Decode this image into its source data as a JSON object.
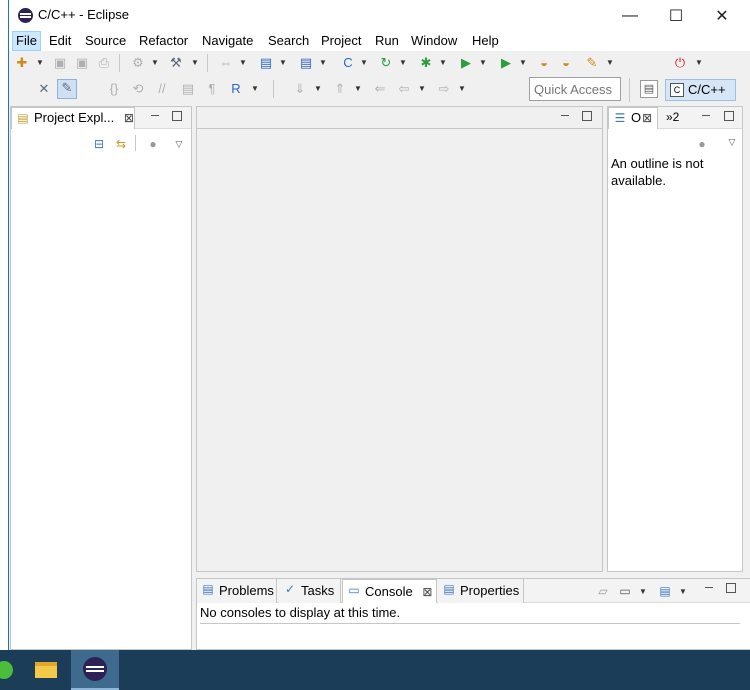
{
  "window": {
    "title": "C/C++ - Eclipse",
    "controls": {
      "minimize": "—",
      "maximize": "☐",
      "close": "✕"
    }
  },
  "menu": [
    "File",
    "Edit",
    "Source",
    "Refactor",
    "Navigate",
    "Search",
    "Project",
    "Run",
    "Window",
    "Help"
  ],
  "quick_access": {
    "placeholder": "Quick Access"
  },
  "perspective": {
    "label": "C/C++"
  },
  "project_explorer": {
    "tab_label": "Project Expl...",
    "close": "⊠"
  },
  "outline": {
    "tab_label": "O",
    "close": "⊠",
    "overflow": "»2",
    "message": "An outline is not available."
  },
  "bottom_panel": {
    "tabs": [
      {
        "label": "Problems",
        "icon": "problems-icon"
      },
      {
        "label": "Tasks",
        "icon": "tasks-icon"
      },
      {
        "label": "Console",
        "icon": "console-icon",
        "close": "⊠"
      },
      {
        "label": "Properties",
        "icon": "properties-icon"
      }
    ],
    "console_message": "No consoles to display at this time."
  },
  "taskbar": {
    "apps": [
      "green-app-icon",
      "file-explorer-icon",
      "eclipse-icon"
    ]
  },
  "colors": {
    "accent": "#1a73c9",
    "taskbar": "#1b3d57",
    "selection": "#cce8ff"
  }
}
